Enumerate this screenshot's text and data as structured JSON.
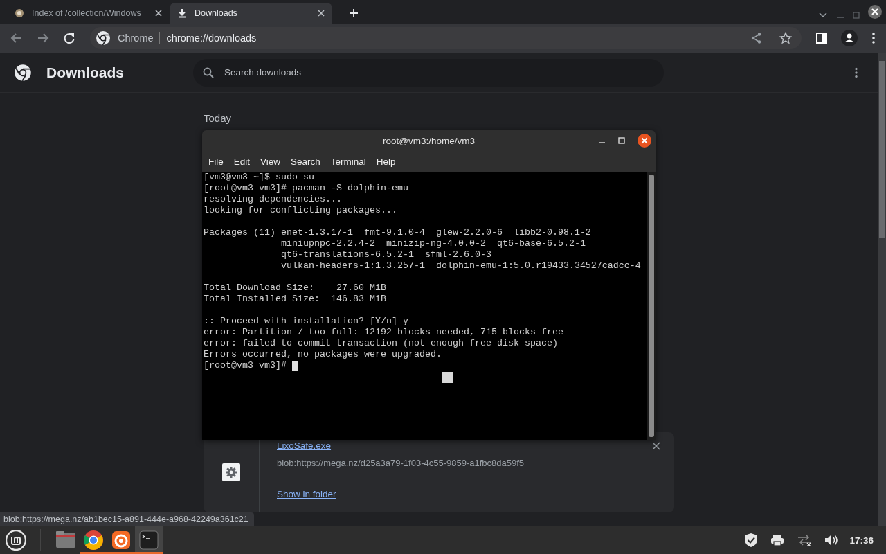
{
  "browser": {
    "tabs": [
      {
        "title": "Index of /collection/Windows",
        "kind": "site",
        "selected": false
      },
      {
        "title": "Downloads",
        "kind": "downloads",
        "selected": true
      }
    ],
    "omnibox": {
      "site_label": "Chrome",
      "url": "chrome://downloads"
    }
  },
  "page": {
    "title": "Downloads",
    "search": {
      "placeholder": "Search downloads"
    },
    "date_heading": "Today",
    "downloads": [
      {
        "file_name": "LixoSafe.exe",
        "url": "blob:https://mega.nz/d25a3a79-1f03-4c55-9859-a1fbc8da59f5",
        "action": "Show in folder"
      }
    ]
  },
  "status_bubble": "blob:https://mega.nz/ab1bec15-a891-444e-a968-42249a361c21",
  "terminal": {
    "title": "root@vm3:/home/vm3",
    "menu": [
      "File",
      "Edit",
      "View",
      "Search",
      "Terminal",
      "Help"
    ],
    "blocks": [
      [
        "[vm3@vm3 ~]$ sudo su",
        "[root@vm3 vm3]# pacman -S dolphin-emu",
        "resolving dependencies...",
        "looking for conflicting packages..."
      ],
      [
        "Packages (11) enet-1.3.17-1  fmt-9.1.0-4  glew-2.2.0-6  libb2-0.98.1-2",
        "              miniupnpc-2.2.4-2  minizip-ng-4.0.0-2  qt6-base-6.5.2-1",
        "              qt6-translations-6.5.2-1  sfml-2.6.0-3",
        "              vulkan-headers-1:1.3.257-1  dolphin-emu-1:5.0.r19433.34527cadcc-4"
      ],
      [
        "Total Download Size:    27.60 MiB",
        "Total Installed Size:  146.83 MiB"
      ],
      [
        ":: Proceed with installation? [Y/n] y",
        "error: Partition / too full: 12192 blocks needed, 715 blocks free",
        "error: failed to commit transaction (not enough free disk space)",
        "Errors occurred, no packages were upgraded."
      ]
    ],
    "prompt": "[root@vm3 vm3]#"
  },
  "taskbar": {
    "apps": [
      {
        "kind": "files",
        "running": false,
        "active": false
      },
      {
        "kind": "chrome",
        "running": true,
        "active": false
      },
      {
        "kind": "firefox",
        "running": true,
        "active": false
      },
      {
        "kind": "terminal",
        "running": true,
        "active": true
      }
    ],
    "clock": "17:36"
  }
}
